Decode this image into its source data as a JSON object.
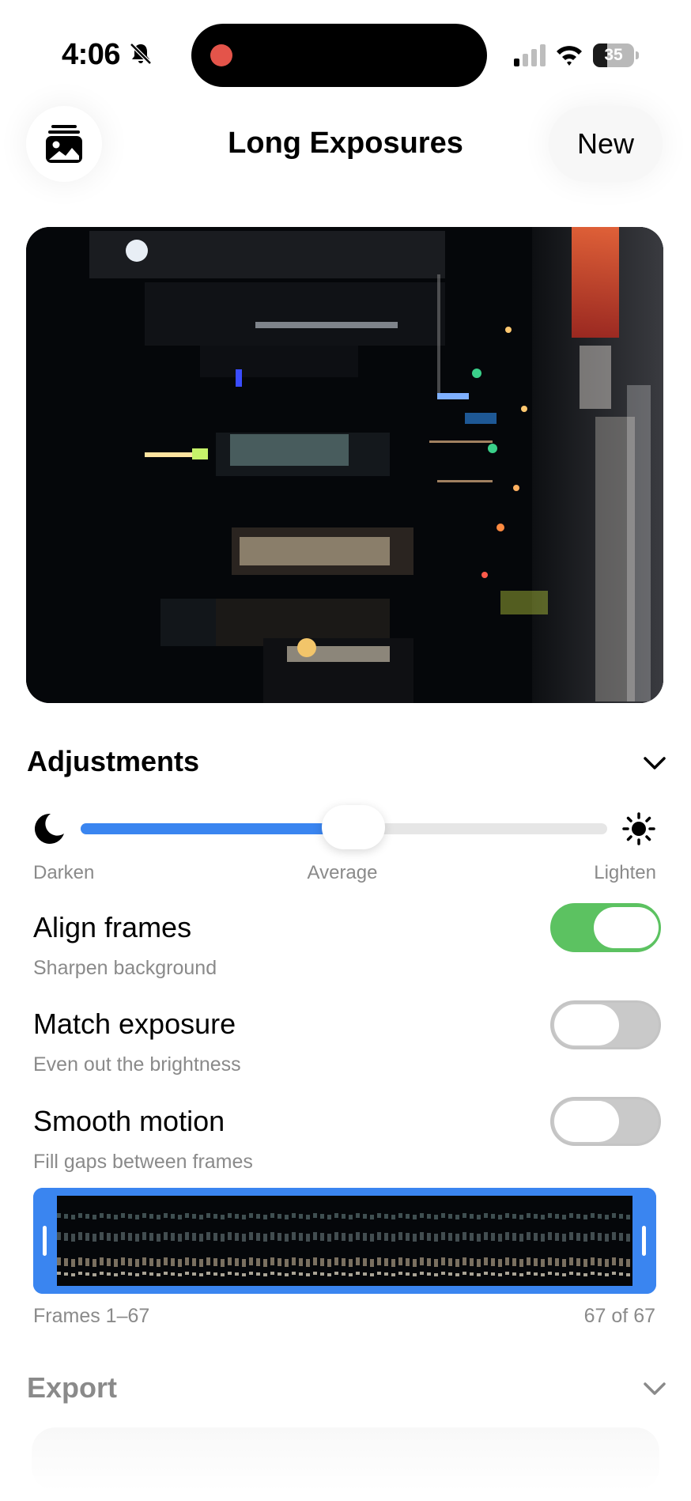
{
  "status_bar": {
    "time": "4:06",
    "battery": "35",
    "battery_level": 0.35,
    "icons": [
      "bell-slash-icon",
      "recording-dot-icon",
      "cellular-signal-icon",
      "wifi-icon",
      "battery-icon"
    ]
  },
  "nav": {
    "title": "Long Exposures",
    "gallery_icon": "photo-stack-icon",
    "new_label": "New"
  },
  "preview": {
    "icon": "night-city-photo"
  },
  "adjustments": {
    "title": "Adjustments",
    "blend_slider": {
      "left_label": "Darken",
      "center_label": "Average",
      "right_label": "Lighten",
      "value": 0.5,
      "left_icon": "moon-icon",
      "right_icon": "sun-icon"
    },
    "options": [
      {
        "title": "Align frames",
        "subtitle": "Sharpen background",
        "enabled": true
      },
      {
        "title": "Match exposure",
        "subtitle": "Even out the brightness",
        "enabled": false
      },
      {
        "title": "Smooth motion",
        "subtitle": "Fill gaps between frames",
        "enabled": false
      }
    ]
  },
  "frames": {
    "range_label": "Frames 1–67",
    "count_label": "67 of 67"
  },
  "export": {
    "title": "Export"
  },
  "colors": {
    "accent": "#3a85f0",
    "toggle_on": "#5cc261",
    "secondary_text": "#8a8a8a"
  }
}
